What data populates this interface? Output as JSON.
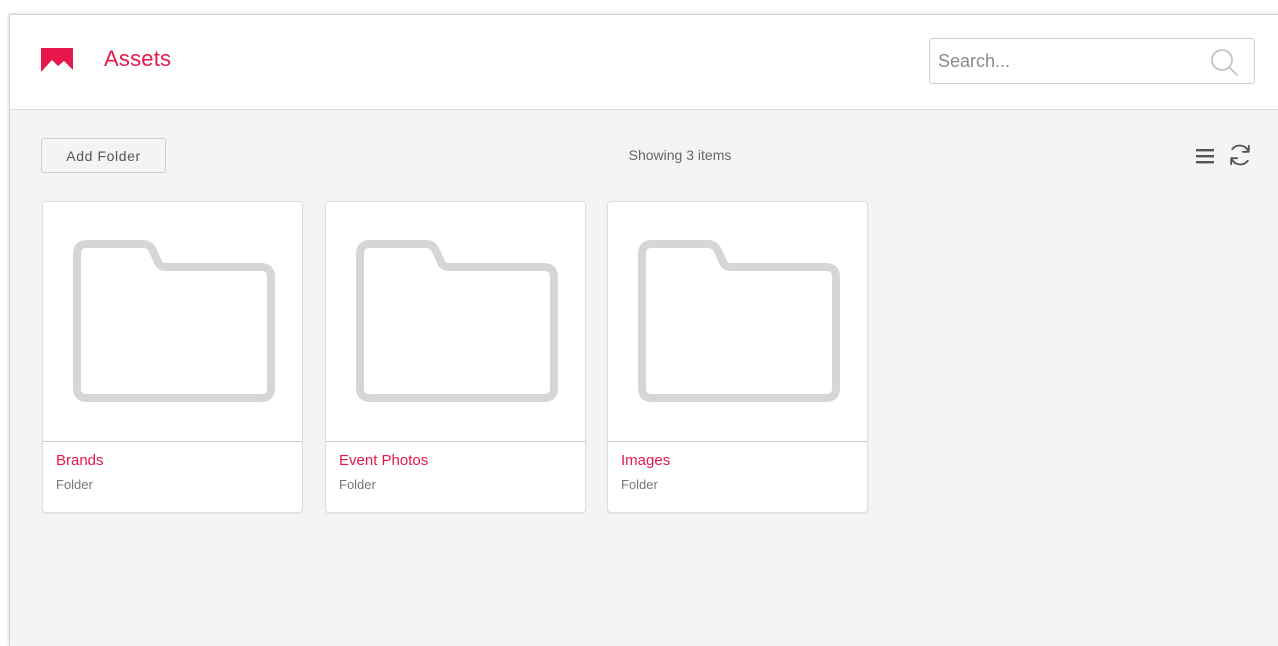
{
  "header": {
    "title": "Assets",
    "logo_icon": "image-icon",
    "search": {
      "placeholder": "Search...",
      "value": "",
      "icon": "search-icon"
    }
  },
  "toolbar": {
    "add_folder_label": "Add Folder",
    "count_text": "Showing 3 items",
    "list_view_icon": "list-view-icon",
    "refresh_icon": "refresh-icon"
  },
  "items": [
    {
      "name": "Brands",
      "type": "Folder",
      "icon": "folder-icon"
    },
    {
      "name": "Event Photos",
      "type": "Folder",
      "icon": "folder-icon"
    },
    {
      "name": "Images",
      "type": "Folder",
      "icon": "folder-icon"
    }
  ],
  "colors": {
    "accent": "#e8174b",
    "background": "#f4f4f4",
    "folder_icon": "#d6d6d6"
  }
}
